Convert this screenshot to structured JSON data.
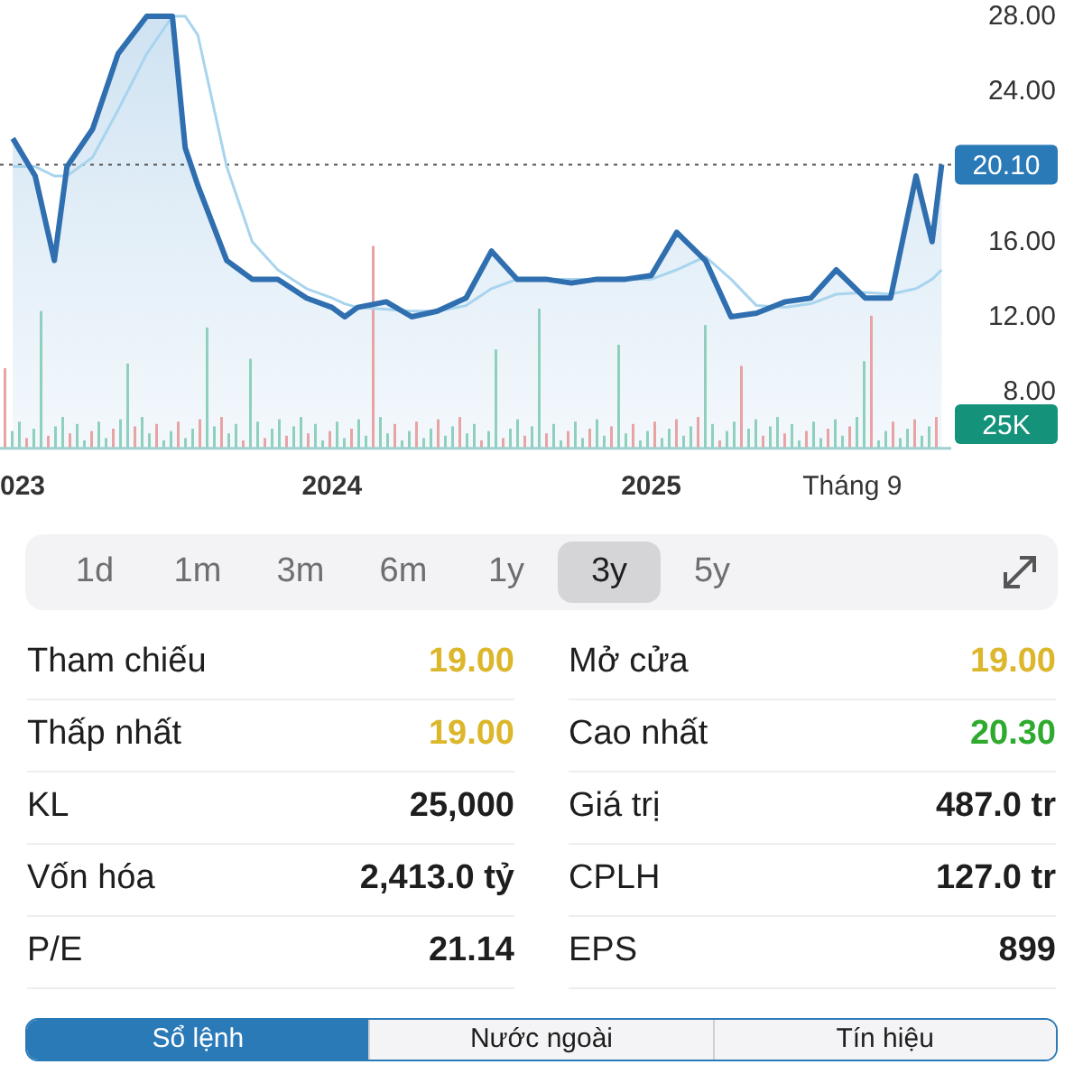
{
  "chart": {
    "first_year_label": "023",
    "last_price": "20.10",
    "last_volume": "25K",
    "chart_data": {
      "type": "line",
      "x": [
        2023,
        2023.07,
        2023.13,
        2023.17,
        2023.25,
        2023.33,
        2023.42,
        2023.5,
        2023.54,
        2023.58,
        2023.67,
        2023.75,
        2023.83,
        2023.92,
        2024,
        2024.04,
        2024.08,
        2024.17,
        2024.25,
        2024.33,
        2024.42,
        2024.5,
        2024.58,
        2024.67,
        2024.75,
        2024.83,
        2024.92,
        2025,
        2025.08,
        2025.17,
        2025.25,
        2025.33,
        2025.42,
        2025.5,
        2025.58,
        2025.67,
        2025.75,
        2025.83,
        2025.88,
        2025.91
      ],
      "series": [
        {
          "color": "#2f6fb0",
          "values": [
            21.5,
            19.5,
            15,
            20,
            22,
            26,
            28,
            28,
            21,
            19,
            15,
            14,
            14,
            13,
            12.5,
            12,
            12.5,
            12.8,
            12,
            12.3,
            13,
            15.5,
            14,
            14,
            13.8,
            14,
            14,
            14.2,
            16.5,
            15,
            12,
            12.2,
            12.8,
            13,
            14.5,
            13,
            13,
            19.5,
            16,
            20.1
          ]
        },
        {
          "color": "#a8d4ee",
          "values": [
            20,
            20,
            19.5,
            19.5,
            20.5,
            23,
            26,
            28,
            28,
            27,
            20,
            16,
            14.5,
            13.5,
            13,
            12.7,
            12.5,
            12.4,
            12.3,
            12.3,
            12.6,
            13.5,
            14,
            14,
            14,
            14,
            14,
            14,
            14.5,
            15.2,
            14,
            12.6,
            12.5,
            12.7,
            13.2,
            13.3,
            13.2,
            13.5,
            14,
            14.5
          ]
        }
      ],
      "xlim": [
        2022.96,
        2025.94
      ],
      "ylim": [
        5,
        28
      ],
      "xticks": [
        {
          "value": 2024,
          "label": "2024"
        },
        {
          "value": 2025,
          "label": "2025"
        },
        {
          "value": 2025.63,
          "label": "Tháng 9"
        }
      ],
      "yticks": [
        {
          "value": 28,
          "label": "28.00"
        },
        {
          "value": 24,
          "label": "24.00"
        },
        {
          "value": 16,
          "label": "16.00"
        },
        {
          "value": 12,
          "label": "12.00"
        },
        {
          "value": 8,
          "label": "8.00"
        }
      ]
    }
  },
  "periods": [
    {
      "label": "1d",
      "selected": false
    },
    {
      "label": "1m",
      "selected": false
    },
    {
      "label": "3m",
      "selected": false
    },
    {
      "label": "6m",
      "selected": false
    },
    {
      "label": "1y",
      "selected": false
    },
    {
      "label": "3y",
      "selected": true
    },
    {
      "label": "5y",
      "selected": false
    }
  ],
  "stats": [
    {
      "label": "Tham chiếu",
      "value": "19.00",
      "color": "#dcb62b"
    },
    {
      "label": "Mở cửa",
      "value": "19.00",
      "color": "#dcb62b"
    },
    {
      "label": "Thấp nhất",
      "value": "19.00",
      "color": "#dcb62b"
    },
    {
      "label": "Cao nhất",
      "value": "20.30",
      "color": "#2eab2e"
    },
    {
      "label": "KL",
      "value": "25,000",
      "color": "#1e1e1e"
    },
    {
      "label": "Giá trị",
      "value": "487.0 tr",
      "color": "#1e1e1e"
    },
    {
      "label": "Vốn hóa",
      "value": "2,413.0 tỷ",
      "color": "#1e1e1e"
    },
    {
      "label": "CPLH",
      "value": "127.0 tr",
      "color": "#1e1e1e"
    },
    {
      "label": "P/E",
      "value": "21.14",
      "color": "#1e1e1e"
    },
    {
      "label": "EPS",
      "value": "899",
      "color": "#1e1e1e"
    }
  ],
  "bottom_tabs": [
    {
      "label": "Sổ lệnh",
      "selected": true
    },
    {
      "label": "Nước ngoài",
      "selected": false
    },
    {
      "label": "Tín hiệu",
      "selected": false
    }
  ]
}
